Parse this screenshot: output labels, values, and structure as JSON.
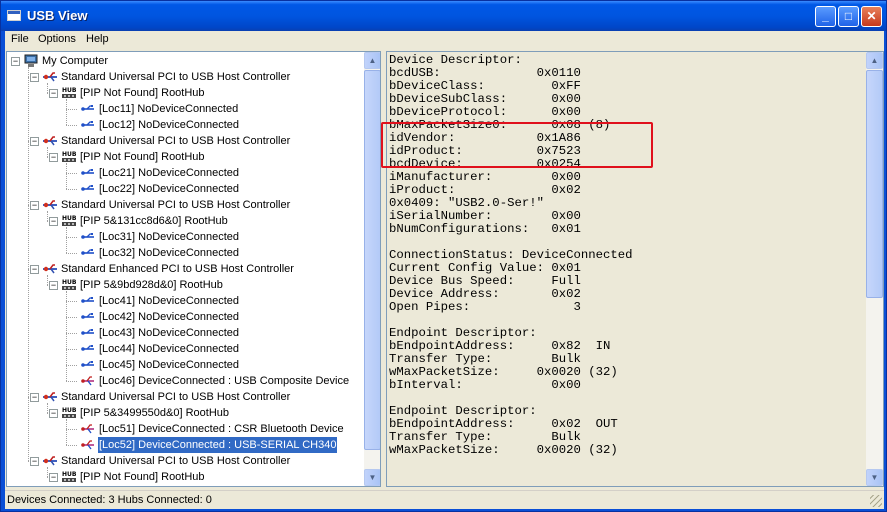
{
  "window": {
    "title": "USB View"
  },
  "menu": {
    "file": "File",
    "options": "Options",
    "help": "Help"
  },
  "tree": [
    {
      "depth": 0,
      "icon": "computer-icon",
      "label": "My Computer",
      "expanded": true
    },
    {
      "depth": 1,
      "icon": "usb-controller-icon",
      "label": "Standard Universal PCI to USB Host Controller",
      "expanded": true
    },
    {
      "depth": 2,
      "icon": "hub-icon",
      "label": "[PIP Not Found] RootHub",
      "expanded": true
    },
    {
      "depth": 3,
      "icon": "usb-port-icon",
      "label": "[Loc11] NoDeviceConnected"
    },
    {
      "depth": 3,
      "icon": "usb-port-icon",
      "label": "[Loc12] NoDeviceConnected"
    },
    {
      "depth": 1,
      "icon": "usb-controller-icon",
      "label": "Standard Universal PCI to USB Host Controller",
      "expanded": true
    },
    {
      "depth": 2,
      "icon": "hub-icon",
      "label": "[PIP Not Found] RootHub",
      "expanded": true
    },
    {
      "depth": 3,
      "icon": "usb-port-icon",
      "label": "[Loc21] NoDeviceConnected"
    },
    {
      "depth": 3,
      "icon": "usb-port-icon",
      "label": "[Loc22] NoDeviceConnected"
    },
    {
      "depth": 1,
      "icon": "usb-controller-icon",
      "label": "Standard Universal PCI to USB Host Controller",
      "expanded": true
    },
    {
      "depth": 2,
      "icon": "hub-icon",
      "label": "[PIP 5&131cc8d6&0] RootHub",
      "expanded": true
    },
    {
      "depth": 3,
      "icon": "usb-port-icon",
      "label": "[Loc31] NoDeviceConnected"
    },
    {
      "depth": 3,
      "icon": "usb-port-icon",
      "label": "[Loc32] NoDeviceConnected"
    },
    {
      "depth": 1,
      "icon": "usb-controller-icon",
      "label": "Standard Enhanced PCI to USB Host Controller",
      "expanded": true
    },
    {
      "depth": 2,
      "icon": "hub-icon",
      "label": "[PIP 5&9bd928d&0] RootHub",
      "expanded": true
    },
    {
      "depth": 3,
      "icon": "usb-port-icon",
      "label": "[Loc41] NoDeviceConnected"
    },
    {
      "depth": 3,
      "icon": "usb-port-icon",
      "label": "[Loc42] NoDeviceConnected"
    },
    {
      "depth": 3,
      "icon": "usb-port-icon",
      "label": "[Loc43] NoDeviceConnected"
    },
    {
      "depth": 3,
      "icon": "usb-port-icon",
      "label": "[Loc44] NoDeviceConnected"
    },
    {
      "depth": 3,
      "icon": "usb-port-icon",
      "label": "[Loc45] NoDeviceConnected"
    },
    {
      "depth": 3,
      "icon": "usb-device-icon",
      "label": "[Loc46] DeviceConnected : USB Composite Device"
    },
    {
      "depth": 1,
      "icon": "usb-controller-icon",
      "label": "Standard Universal PCI to USB Host Controller",
      "expanded": true
    },
    {
      "depth": 2,
      "icon": "hub-icon",
      "label": "[PIP 5&3499550d&0] RootHub",
      "expanded": true
    },
    {
      "depth": 3,
      "icon": "usb-device-icon",
      "label": "[Loc51] DeviceConnected : CSR Bluetooth Device"
    },
    {
      "depth": 3,
      "icon": "usb-device-icon",
      "label": "[Loc52] DeviceConnected : USB-SERIAL CH340",
      "selected": true
    },
    {
      "depth": 1,
      "icon": "usb-controller-icon",
      "label": "Standard Universal PCI to USB Host Controller",
      "expanded": true
    },
    {
      "depth": 2,
      "icon": "hub-icon",
      "label": "[PIP Not Found] RootHub",
      "expanded": true
    }
  ],
  "detail_lines": [
    "Device Descriptor:",
    "bcdUSB:             0x0110",
    "bDeviceClass:         0xFF",
    "bDeviceSubClass:      0x00",
    "bDeviceProtocol:      0x00",
    "bMaxPacketSize0:      0x08 (8)",
    "idVendor:           0x1A86",
    "idProduct:          0x7523",
    "bcdDevice:          0x0254",
    "iManufacturer:        0x00",
    "iProduct:             0x02",
    "0x0409: \"USB2.0-Ser!\"",
    "iSerialNumber:        0x00",
    "bNumConfigurations:   0x01",
    "",
    "ConnectionStatus: DeviceConnected",
    "Current Config Value: 0x01",
    "Device Bus Speed:     Full",
    "Device Address:       0x02",
    "Open Pipes:              3",
    "",
    "Endpoint Descriptor:",
    "bEndpointAddress:     0x82  IN",
    "Transfer Type:        Bulk",
    "wMaxPacketSize:     0x0020 (32)",
    "bInterval:            0x00",
    "",
    "Endpoint Descriptor:",
    "bEndpointAddress:     0x02  OUT",
    "Transfer Type:        Bulk",
    "wMaxPacketSize:     0x0020 (32)"
  ],
  "status": {
    "text": "Devices Connected: 3   Hubs Connected: 0"
  },
  "colors": {
    "highlight": "#e0101c",
    "selection": "#316ac5",
    "titlebar": "#0058e6"
  }
}
